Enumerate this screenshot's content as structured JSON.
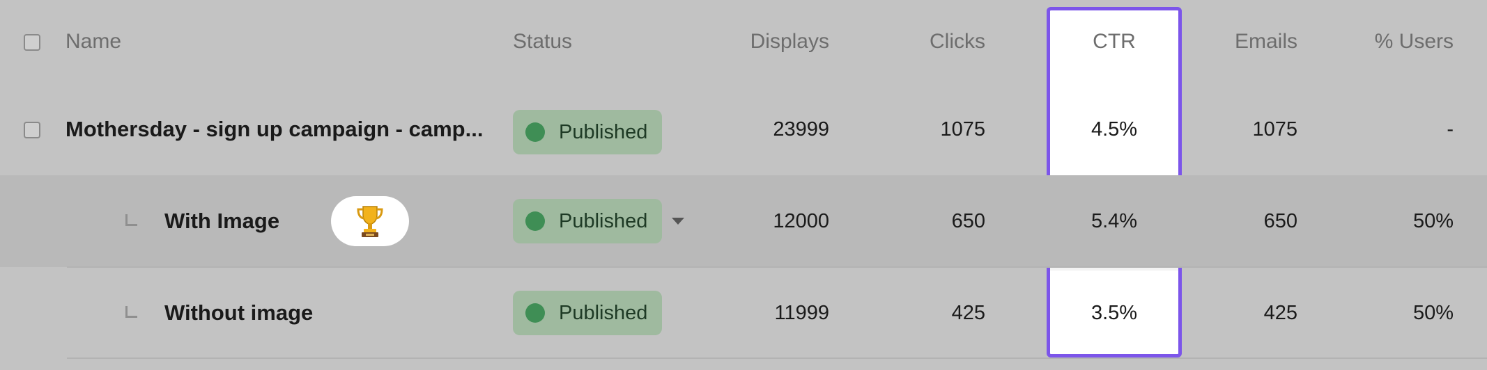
{
  "columns": {
    "name": "Name",
    "status": "Status",
    "displays": "Displays",
    "clicks": "Clicks",
    "ctr": "CTR",
    "emails": "Emails",
    "users": "% Users"
  },
  "rows": [
    {
      "name": "Mothersday - sign up campaign - camp...",
      "status": "Published",
      "displays": "23999",
      "clicks": "1075",
      "ctr": "4.5%",
      "emails": "1075",
      "users": "-"
    },
    {
      "name": "With Image",
      "status": "Published",
      "displays": "12000",
      "clicks": "650",
      "ctr": "5.4%",
      "emails": "650",
      "users": "50%",
      "badge_icon": "trophy-icon"
    },
    {
      "name": "Without image",
      "status": "Published",
      "displays": "11999",
      "clicks": "425",
      "ctr": "3.5%",
      "emails": "425",
      "users": "50%"
    }
  ],
  "colors": {
    "highlight_border": "#7c55ea",
    "status_badge": "#9fba9f",
    "status_dot": "#3f8e55"
  }
}
